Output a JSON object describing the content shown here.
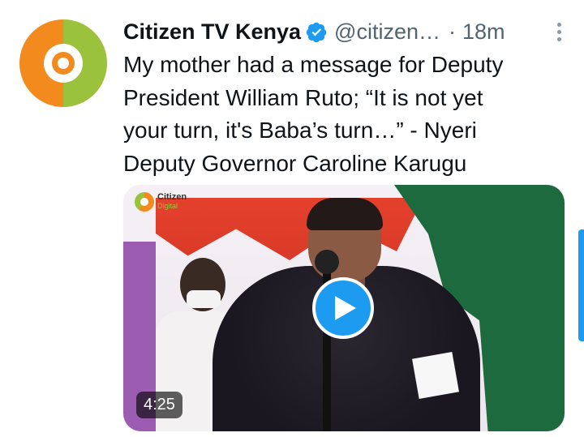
{
  "tweet": {
    "author_name": "Citizen TV Kenya",
    "handle": "@citizen…",
    "separator": "·",
    "time": "18m",
    "text": "My mother had a message for Deputy\nPresident William Ruto; “It is not yet\nyour turn, it's Baba’s turn…” - Nyeri\nDeputy Governor Caroline Karugu"
  },
  "media": {
    "duration": "4:25",
    "watermark_line1": "Citizen",
    "watermark_line2": "Digital"
  },
  "colors": {
    "accent": "#1d9bf0",
    "brand_orange": "#f28a1e",
    "brand_green": "#9ac23c",
    "muted_text": "#536471"
  },
  "icons": {
    "verified": "verified-badge-icon",
    "more": "more-vertical-icon",
    "play": "play-icon"
  }
}
